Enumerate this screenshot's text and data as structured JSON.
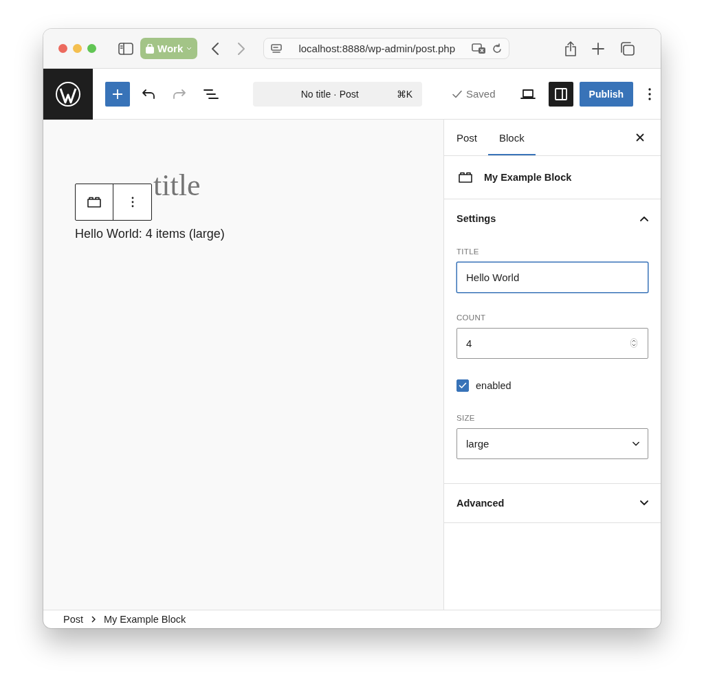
{
  "browser": {
    "tab_group": "Work",
    "url": "localhost:8888/wp-admin/post.php"
  },
  "toolbar": {
    "command": "No title · Post",
    "shortcut": "⌘K",
    "save_status": "Saved",
    "publish": "Publish",
    "sidebar_open": true,
    "redo_disabled": true
  },
  "editor": {
    "title_placeholder": "title",
    "paragraph": "Hello World: 4 items (large)"
  },
  "sidebar": {
    "tabs": [
      {
        "label": "Post",
        "selected": false
      },
      {
        "label": "Block",
        "selected": true
      }
    ],
    "block_name": "My Example Block",
    "panels": [
      {
        "title": "Settings",
        "expanded": true,
        "fields": [
          {
            "kind": "text",
            "label": "TITLE",
            "value": "Hello World",
            "focused": true
          },
          {
            "kind": "number",
            "label": "COUNT",
            "value": "4",
            "focused": false
          },
          {
            "kind": "checkbox",
            "label": "enabled",
            "checked": true
          },
          {
            "kind": "select",
            "label": "SIZE",
            "value": "large"
          }
        ]
      },
      {
        "title": "Advanced",
        "expanded": false
      }
    ]
  },
  "breadcrumbs": [
    "Post",
    "My Example Block"
  ]
}
